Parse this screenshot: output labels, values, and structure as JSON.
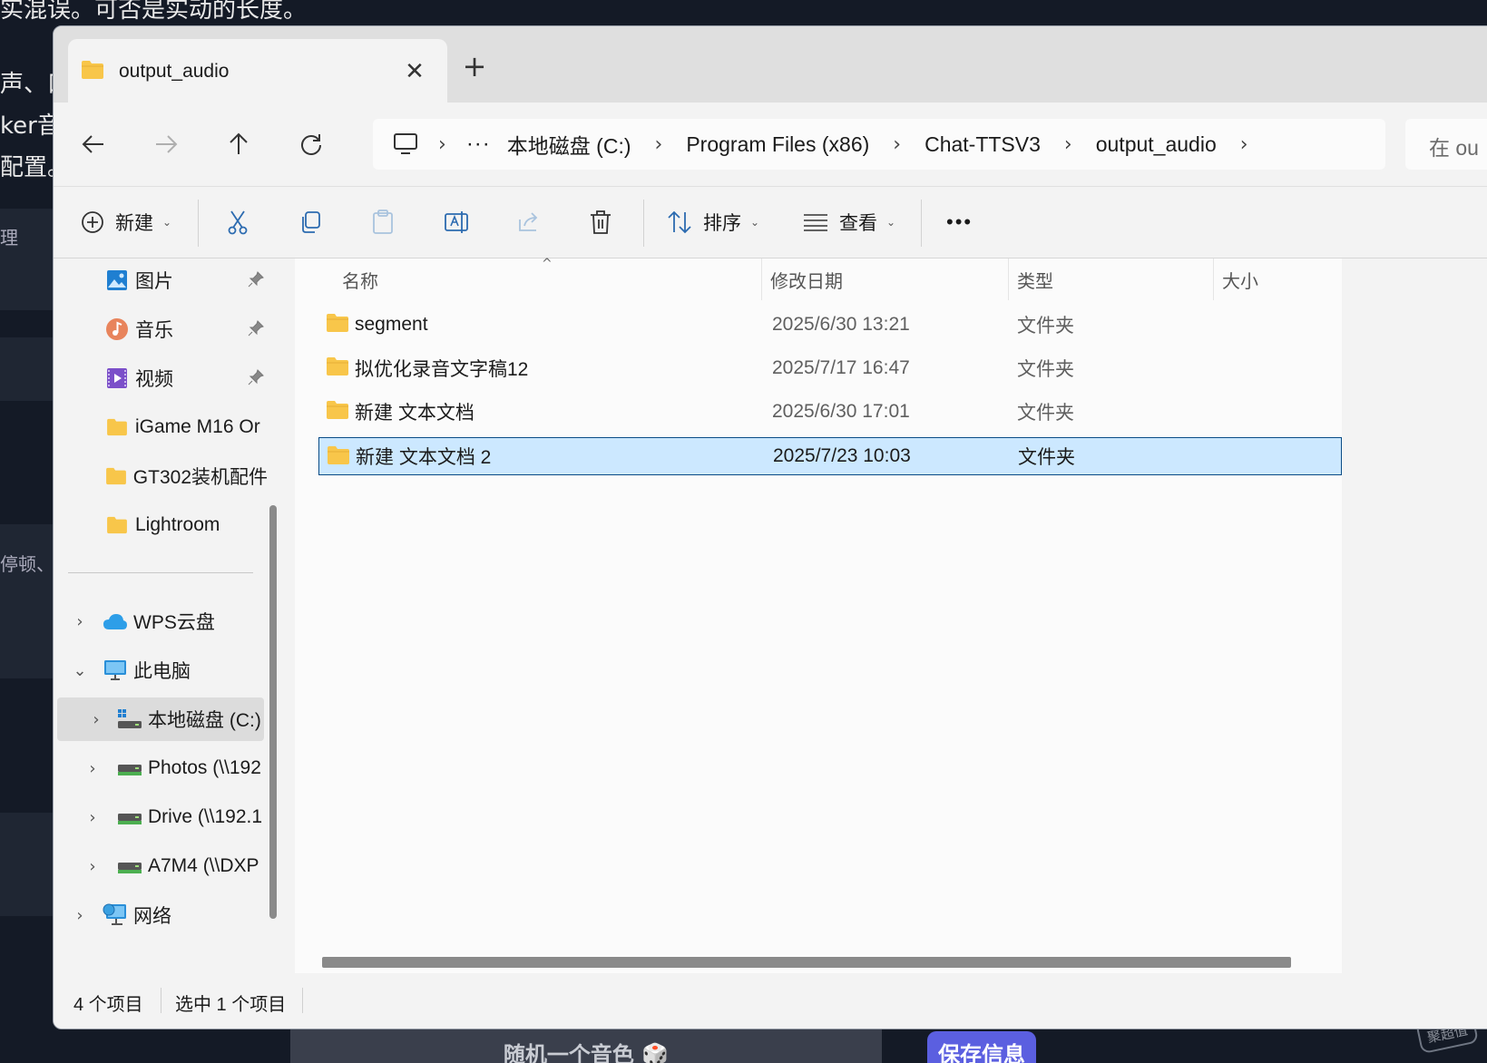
{
  "background": {
    "line1": "实混误。可否是实动的长度。",
    "line2": "声、口",
    "line3": "ker音",
    "line4": "配置。",
    "line5": "理",
    "line6": "停顿、",
    "bottom_button": "随机一个音色 🎲",
    "save_button": "保存信息",
    "watermark": "聚超值"
  },
  "tab": {
    "title": "output_audio",
    "close": "✕",
    "new_tab": "+"
  },
  "address": {
    "more": "···",
    "crumbs": [
      "本地磁盘 (C:)",
      "Program Files (x86)",
      "Chat-TTSV3",
      "output_audio"
    ],
    "search_placeholder": "在 ou"
  },
  "commands": {
    "new": "新建",
    "sort": "排序",
    "view": "查看",
    "more": "•••"
  },
  "navpane": {
    "items": [
      {
        "label": "图片",
        "icon": "pictures-icon",
        "pinned": true
      },
      {
        "label": "音乐",
        "icon": "music-icon",
        "pinned": true
      },
      {
        "label": "视频",
        "icon": "video-icon",
        "pinned": true
      },
      {
        "label": "iGame M16 Or",
        "icon": "folder-icon"
      },
      {
        "label": "GT302装机配件",
        "icon": "folder-icon"
      },
      {
        "label": "Lightroom",
        "icon": "folder-icon"
      },
      {
        "label": "WPS云盘",
        "icon": "cloud-icon"
      },
      {
        "label": "此电脑",
        "icon": "pc-icon"
      },
      {
        "label": "本地磁盘 (C:)",
        "icon": "drive-icon"
      },
      {
        "label": "Photos (\\\\192",
        "icon": "network-drive-icon"
      },
      {
        "label": "Drive (\\\\192.1",
        "icon": "network-drive-icon"
      },
      {
        "label": "A7M4 (\\\\DXP",
        "icon": "network-drive-icon"
      },
      {
        "label": "网络",
        "icon": "network-icon"
      }
    ]
  },
  "columns": {
    "name": "名称",
    "modified": "修改日期",
    "type": "类型",
    "size": "大小"
  },
  "files": [
    {
      "name": "segment",
      "modified": "2025/6/30 13:21",
      "type": "文件夹"
    },
    {
      "name": "拟优化录音文字稿12",
      "modified": "2025/7/17 16:47",
      "type": "文件夹"
    },
    {
      "name": "新建 文本文档",
      "modified": "2025/6/30 17:01",
      "type": "文件夹"
    },
    {
      "name": "新建 文本文档 2",
      "modified": "2025/7/23 10:03",
      "type": "文件夹",
      "selected": true
    }
  ],
  "status": {
    "count": "4 个项目",
    "selected": "选中 1 个项目"
  },
  "colors": {
    "folder": "#f8c64a",
    "selection": "#cce8ff",
    "selection_border": "#0a4c86"
  }
}
